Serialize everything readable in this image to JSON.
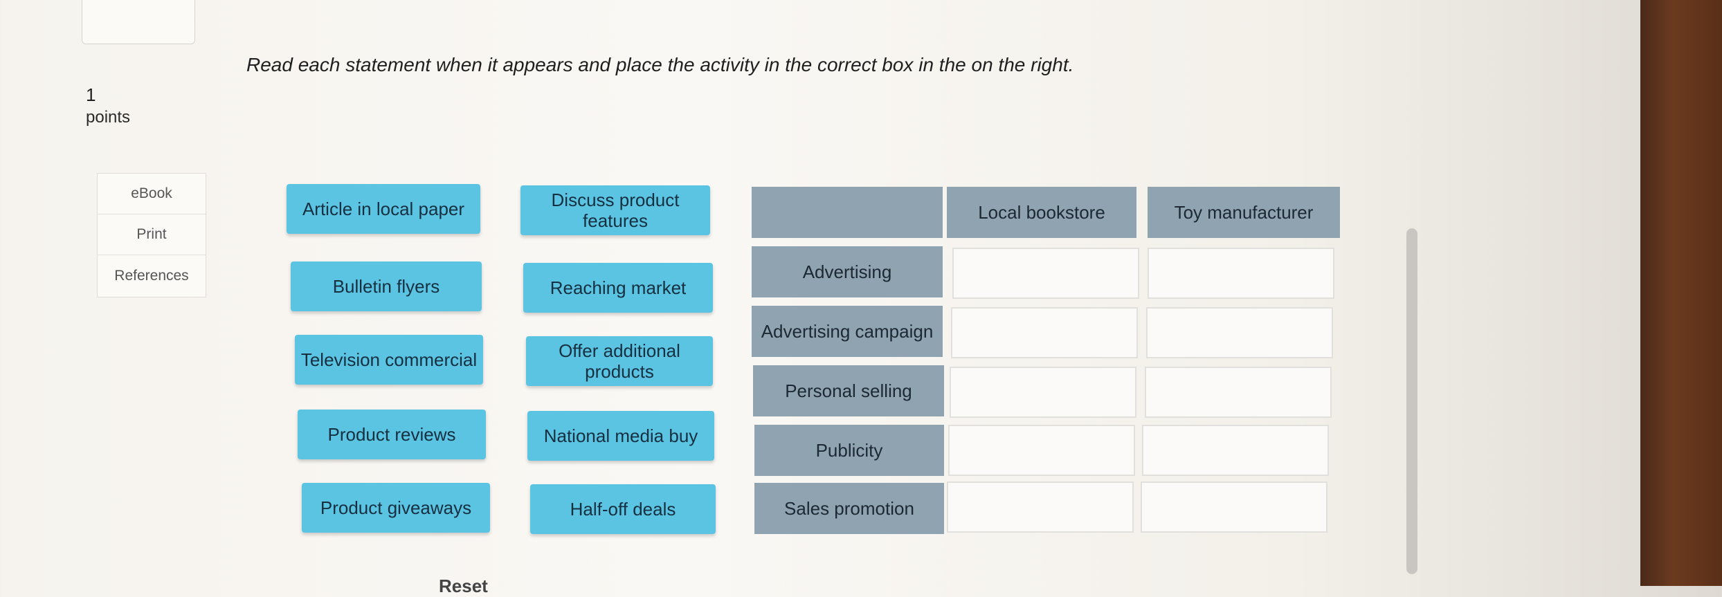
{
  "instruction": "Read each statement when it appears and place the activity in the correct box in the  on the right.",
  "points": {
    "value": "1",
    "label": "points"
  },
  "side_menu": [
    "eBook",
    "Print",
    "References"
  ],
  "chips": [
    {
      "label": "Article in local paper"
    },
    {
      "label": "Discuss product features"
    },
    {
      "label": "Bulletin flyers"
    },
    {
      "label": "Reaching market"
    },
    {
      "label": "Television commercial"
    },
    {
      "label": "Offer additional products"
    },
    {
      "label": "Product reviews"
    },
    {
      "label": "National media buy"
    },
    {
      "label": "Product giveaways"
    },
    {
      "label": "Half-off deals"
    }
  ],
  "table": {
    "columns": [
      "",
      "Local bookstore",
      "Toy manufacturer"
    ],
    "rows": [
      "Advertising",
      "Advertising campaign",
      "Personal selling",
      "Publicity",
      "Sales promotion"
    ]
  },
  "reset_label": "Reset"
}
